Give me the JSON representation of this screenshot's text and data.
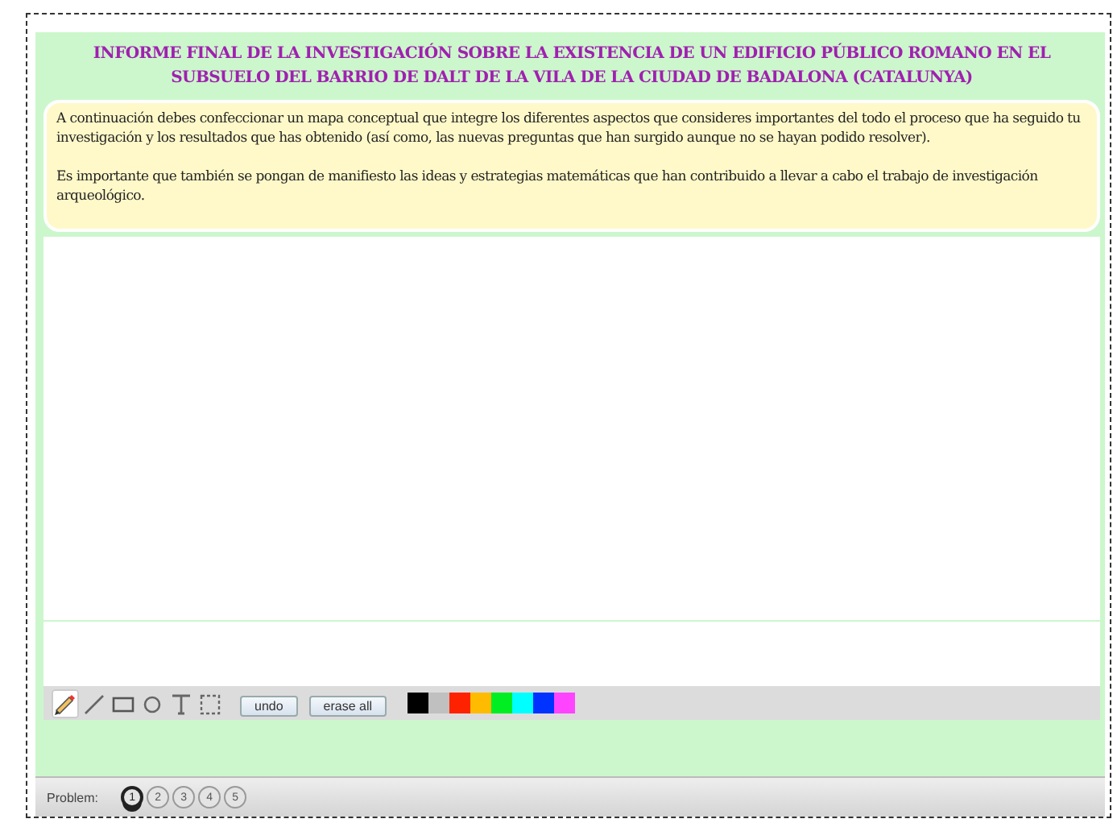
{
  "title": "INFORME FINAL DE LA INVESTIGACIÓN SOBRE LA EXISTENCIA DE UN EDIFICIO PÚBLICO ROMANO EN EL SUBSUELO DEL BARRIO DE DALT DE LA VILA DE LA CIUDAD DE BADALONA (CATALUNYA)",
  "instructions": [
    "A continuación debes confeccionar un mapa conceptual que integre los diferentes aspectos que consideres importantes del todo el proceso que ha seguido tu investigación y los resultados que has obtenido (así como, las nuevas preguntas que han surgido aunque no se hayan podido resolver).",
    "Es importante que también se pongan de manifiesto las ideas y estrategias matemáticas que han contribuido a llevar a cabo el trabajo de investigación arqueológico."
  ],
  "tools": [
    {
      "kind": "pencil",
      "selected": true
    },
    {
      "kind": "line",
      "selected": false
    },
    {
      "kind": "rectangle",
      "selected": false
    },
    {
      "kind": "circle",
      "selected": false
    },
    {
      "kind": "text",
      "selected": false
    },
    {
      "kind": "select",
      "selected": false
    }
  ],
  "buttons": [
    "undo",
    "erase all"
  ],
  "palette": [
    {
      "color": "#000000"
    },
    {
      "color": "#c0c0c0"
    },
    {
      "color": "#ff2200"
    },
    {
      "color": "#ffbb00"
    },
    {
      "color": "#00ee22"
    },
    {
      "color": "#00ffff"
    },
    {
      "color": "#0033ff"
    },
    {
      "color": "#ff44ff"
    }
  ],
  "problem_bar": {
    "label": "Problem:",
    "problems": [
      {
        "label": "1",
        "selected": true
      },
      {
        "label": "2",
        "selected": false
      },
      {
        "label": "3",
        "selected": false
      },
      {
        "label": "4",
        "selected": false
      },
      {
        "label": "5",
        "selected": false
      }
    ]
  }
}
